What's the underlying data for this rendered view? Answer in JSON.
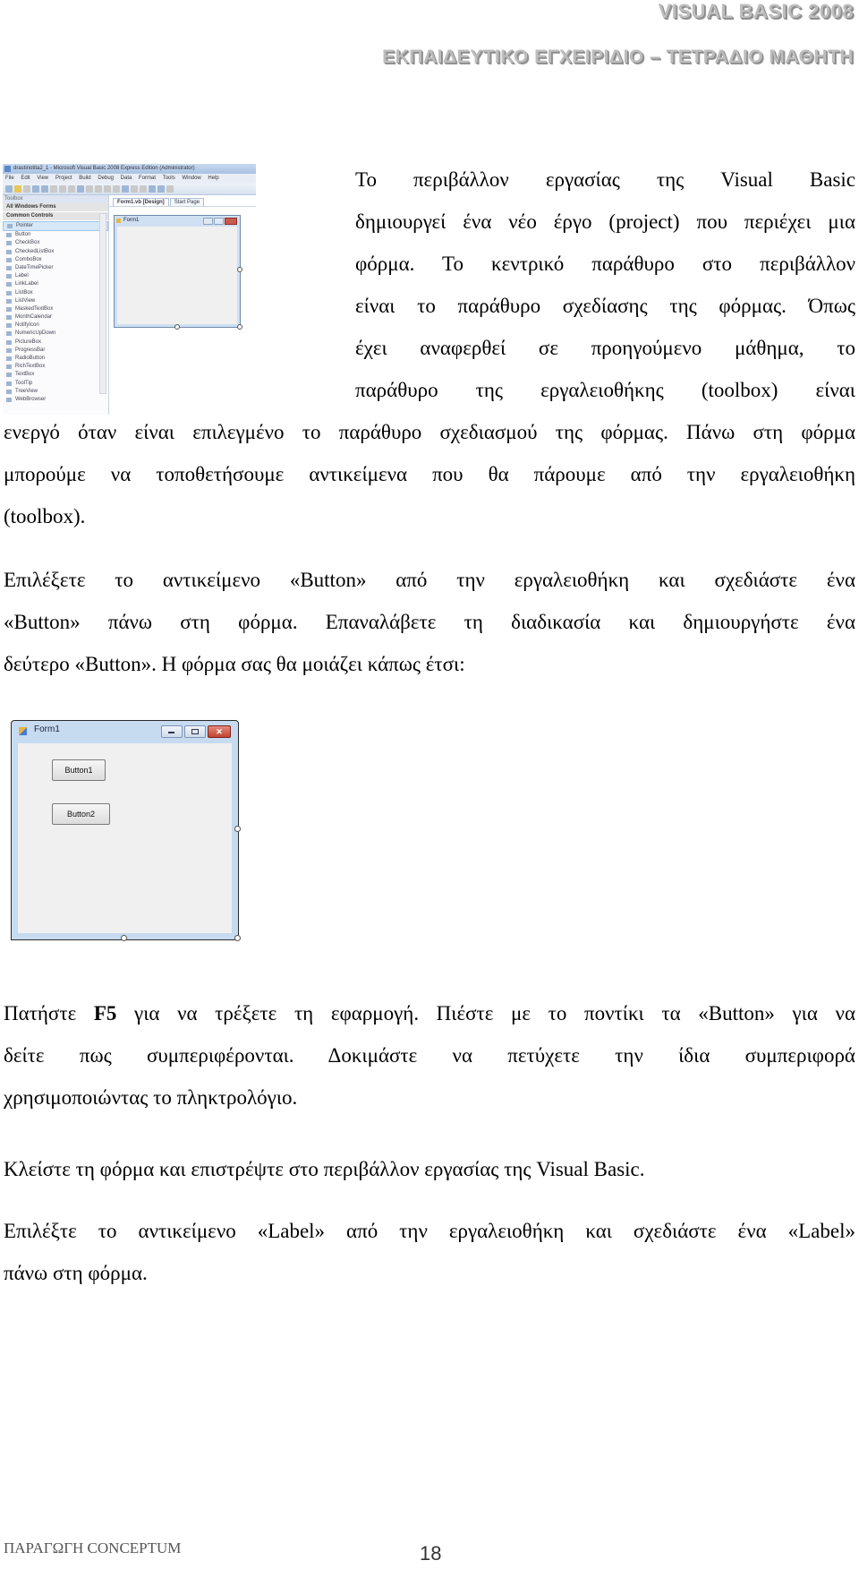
{
  "header": {
    "title": "VISUAL BASIC 2008",
    "subtitle": "ΕΚΠΑΙΔΕΥΤΙΚΟ ΕΓΧΕΙΡΙΔΙΟ – ΤΕΤΡΑΔΙΟ ΜΑΘΗΤΗ"
  },
  "ide_screenshot": {
    "window_title": "drastiriotita2_1 - Microsoft Visual Basic 2008 Express Edition (Administrator)",
    "menu": [
      "File",
      "Edit",
      "View",
      "Project",
      "Build",
      "Debug",
      "Data",
      "Format",
      "Tools",
      "Window",
      "Help"
    ],
    "toolbox_title": "Toolbox",
    "groups": [
      "All Windows Forms",
      "Common Controls"
    ],
    "toolbox_items": [
      "Pointer",
      "Button",
      "CheckBox",
      "CheckedListBox",
      "ComboBox",
      "DateTimePicker",
      "Label",
      "LinkLabel",
      "ListBox",
      "ListView",
      "MaskedTextBox",
      "MonthCalendar",
      "NotifyIcon",
      "NumericUpDown",
      "PictureBox",
      "ProgressBar",
      "RadioButton",
      "RichTextBox",
      "TextBox",
      "ToolTip",
      "TreeView",
      "WebBrowser"
    ],
    "tabs": [
      "Form1.vb [Design]",
      "Start Page"
    ],
    "form_title": "Form1"
  },
  "paragraphs": {
    "p1": [
      "Το περιβάλλον εργασίας της Visual Basic",
      "δημιουργεί ένα νέο έργο (project) που περιέχει μια",
      "φόρμα. Το κεντρικό παράθυρο στο περιβάλλον",
      "είναι το παράθυρο σχεδίασης της φόρμας. Όπως",
      "έχει αναφερθεί σε προηγούμενο μάθημα, το",
      "παράθυρο της εργαλειοθήκης (toolbox) είναι",
      "ενεργό όταν είναι επιλεγμένο το παράθυρο σχεδιασμού της φόρμας. Πάνω στη φόρμα",
      "μπορούμε να τοποθετήσουμε αντικείμενα που θα πάρουμε από την εργαλειοθήκη",
      "(toolbox)."
    ],
    "p2": [
      "Επιλέξετε το αντικείμενο «Button» από την εργαλειοθήκη και σχεδιάστε ένα",
      "«Button» πάνω στη φόρμα. Επαναλάβετε τη διαδικασία και δημιουργήστε ένα",
      "δεύτερο «Button». Η φόρμα σας θα μοιάζει κάπως έτσι:"
    ],
    "p3": {
      "line1_pre": "Πατήστε ",
      "line1_key": "F5",
      "line1_post": " για να τρέξετε τη εφαρμογή. Πιέστε με το ποντίκι τα «Button» για να",
      "line2": "δείτε πως συμπεριφέρονται. Δοκιμάστε να πετύχετε την ίδια συμπεριφορά",
      "line3": "χρησιμοποιώντας το πληκτρολόγιο."
    },
    "p4": "Κλείστε τη φόρμα και επιστρέψτε στο περιβάλλον εργασίας της Visual Basic.",
    "p5": [
      "Επιλέξτε το αντικείμενο «Label» από την εργαλειοθήκη και σχεδιάστε ένα «Label»",
      "πάνω στη φόρμα."
    ]
  },
  "form1_screenshot": {
    "title": "Form1",
    "button1": "Button1",
    "button2": "Button2",
    "close_glyph": "✕"
  },
  "footer": {
    "producer": "ΠΑΡΑΓΩΓΗ CONCEPTUM",
    "page_number": "18"
  }
}
